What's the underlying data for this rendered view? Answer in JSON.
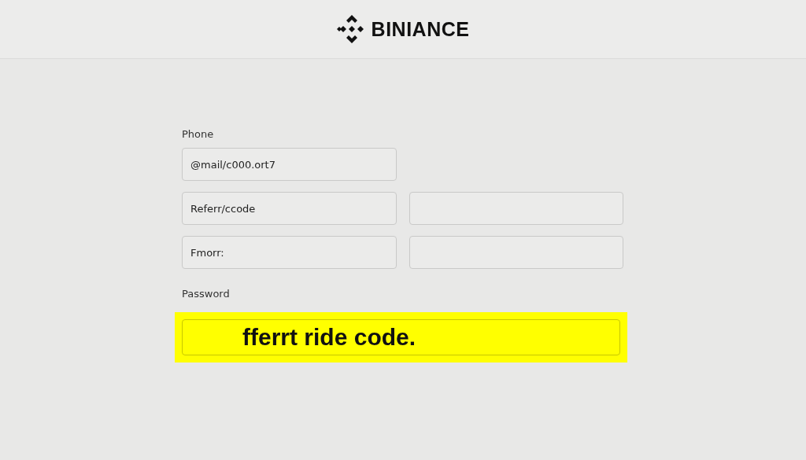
{
  "header": {
    "logo_text": "BINIANCE"
  },
  "form": {
    "phone_label": "Phone",
    "rows": [
      {
        "fields": [
          {
            "kind": "filled",
            "value": "@mail/c000.ort7"
          }
        ]
      },
      {
        "fields": [
          {
            "kind": "filled",
            "value": "Referr/ccode"
          },
          {
            "kind": "blank"
          }
        ]
      },
      {
        "fields": [
          {
            "kind": "filled",
            "value": "Fmorr:"
          },
          {
            "kind": "blank"
          }
        ]
      }
    ],
    "password_label": "Password",
    "password_field": {
      "value": "fferrt ride code.",
      "highlighted": true
    }
  }
}
